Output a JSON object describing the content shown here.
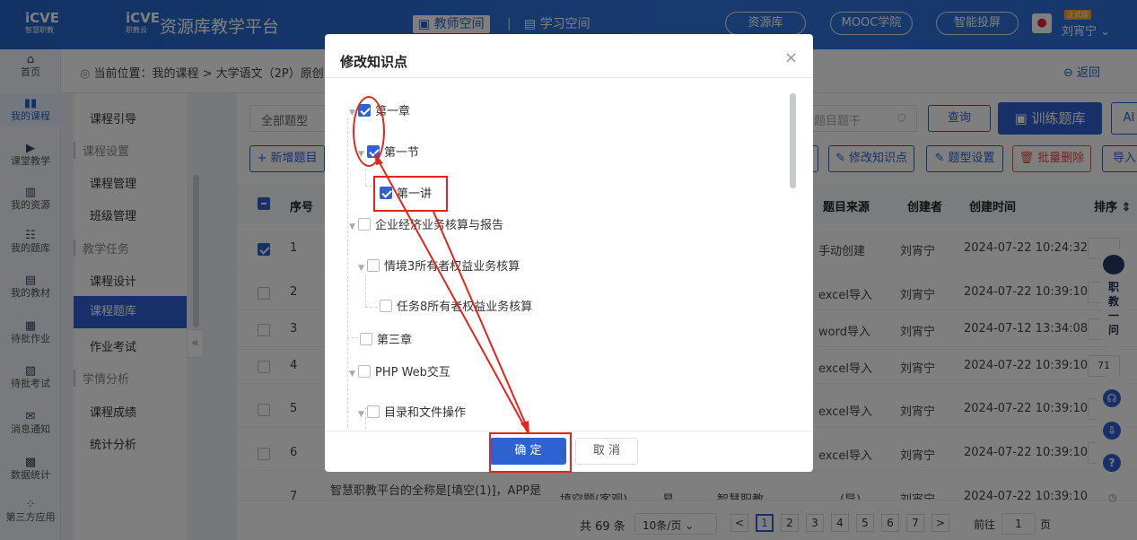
{
  "topbar": {
    "logo1_text": "iCVE",
    "logo1_sub": "智慧职教",
    "logo2_text": "iCVE",
    "logo2_sub": "职教云",
    "title": "资源库教学平台",
    "teacher_space": "教师空间",
    "study_space": "学习空间",
    "pills": [
      "资源库",
      "MOOC学院",
      "智能投屏"
    ],
    "badge": "正式版",
    "user": "刘宵宁 ⌄"
  },
  "sidebar": {
    "items": [
      {
        "icon": "⌂",
        "label": "首页"
      },
      {
        "icon": "▮▮",
        "label": "我的课程"
      },
      {
        "icon": "▶",
        "label": "课堂教学"
      },
      {
        "icon": "▥",
        "label": "我的资源"
      },
      {
        "icon": "☷",
        "label": "我的题库"
      },
      {
        "icon": "▤",
        "label": "我的教材"
      },
      {
        "icon": "▦",
        "label": "待批作业"
      },
      {
        "icon": "▧",
        "label": "待批考试"
      },
      {
        "icon": "✉",
        "label": "消息通知"
      },
      {
        "icon": "▩",
        "label": "数据统计"
      },
      {
        "icon": "⁘",
        "label": "第三方应用"
      }
    ]
  },
  "breadcrumb": {
    "text": "当前位置：我的课程 > 大学语文（2P）原创",
    "back": "⊖ 返回"
  },
  "submenu": {
    "intro": "课程引导",
    "group1": "课程设置",
    "course_manage": "课程管理",
    "class_manage": "班级管理",
    "group2": "教学任务",
    "course_design": "课程设计",
    "question_bank": "课程题库",
    "homework": "作业考试",
    "group3": "学情分析",
    "grades": "课程成绩",
    "stats": "统计分析"
  },
  "toolbar": {
    "type_select": "全部题型",
    "search_placeholder": "题目题干",
    "query": "查询",
    "train": "▣ 训练题库",
    "ai": "AI",
    "add": "+ 新增题目",
    "edit_kp": "✎ 修改知识点",
    "type_setting": "✎ 题型设置",
    "batch_delete": "🗑 批量删除",
    "import": "导入"
  },
  "table": {
    "headers": [
      "序号",
      "题目来源",
      "创建者",
      "创建时间",
      "排序 ⇕"
    ],
    "rows": [
      {
        "no": "1",
        "source": "手动创建",
        "creator": "刘宵宁",
        "time": "2024-07-22 10:24:32",
        "sort": "",
        "checked": true
      },
      {
        "no": "2",
        "source": "excel导入",
        "creator": "刘宵宁",
        "time": "2024-07-22 10:39:10",
        "sort": "",
        "checked": false
      },
      {
        "no": "3",
        "source": "word导入",
        "creator": "刘宵宁",
        "time": "2024-07-12 13:34:08",
        "sort": "",
        "checked": false
      },
      {
        "no": "4",
        "source": "excel导入",
        "creator": "刘宵宁",
        "time": "2024-07-22 10:39:10",
        "sort": "71",
        "checked": false
      },
      {
        "no": "5",
        "source": "excel导入",
        "creator": "刘宵宁",
        "time": "2024-07-22 10:39:10",
        "sort": "",
        "checked": false
      },
      {
        "no": "6",
        "source": "excel导入",
        "creator": "刘宵宁",
        "time": "2024-07-22 10:39:10",
        "sort": "",
        "checked": false
      }
    ],
    "partial_row": {
      "no": "7",
      "stem": "智慧职教平台的全称是[填空(1)]，APP是",
      "type": "填空题(客观)",
      "difficulty": "易",
      "kp": "智慧职教",
      "source": "(导)",
      "creator": "刘宵宁",
      "time": "2024-07-22 10:39:10"
    }
  },
  "pager": {
    "total": "共 69 条",
    "size": "10条/页 ⌄",
    "prev": "<",
    "next": ">",
    "pages": [
      "1",
      "2",
      "3",
      "4",
      "5",
      "6",
      "7"
    ],
    "goto_label": "前往",
    "goto_value": "1",
    "goto_suffix": "页"
  },
  "robot": {
    "text": "职教一问"
  },
  "modal": {
    "title": "修改知识点",
    "close": "×",
    "nodes": [
      {
        "label": "第一章",
        "checked": true
      },
      {
        "label": "第一节",
        "checked": true
      },
      {
        "label": "第一讲",
        "checked": true
      },
      {
        "label": "企业经济业务核算与报告",
        "checked": false
      },
      {
        "label": "情境3所有者权益业务核算",
        "checked": false
      },
      {
        "label": "任务8所有者权益业务核算",
        "checked": false
      },
      {
        "label": "第三章",
        "checked": false
      },
      {
        "label": "PHP Web交互",
        "checked": false
      },
      {
        "label": "目录和文件操作",
        "checked": false
      }
    ],
    "ok": "确 定",
    "cancel": "取 消"
  },
  "colors": {
    "primary": "#2f62d1",
    "annotation": "#e8231b",
    "topbar": "#2563c9"
  }
}
